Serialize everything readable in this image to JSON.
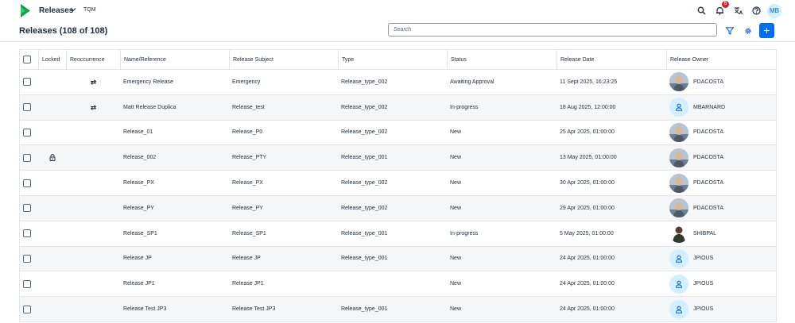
{
  "shell": {
    "app_title": "Releases",
    "app_subtitle": "TQM",
    "notification_count": "5",
    "user_initials": "MB"
  },
  "page": {
    "title": "Releases (108 of 108)",
    "search_placeholder": "Search",
    "add_label": "+"
  },
  "colors": {
    "accent": "#0070f2",
    "badge": "#d32030",
    "logo_green": "#1a9f4b"
  },
  "table": {
    "columns": {
      "locked": "Locked",
      "reoccurrence": "Reoccurrence",
      "name": "Name/Reference",
      "subject": "Release Subject",
      "type": "Type",
      "status": "Status",
      "date": "Release Date",
      "owner": "Release Owner"
    },
    "rows": [
      {
        "locked": false,
        "recurring": true,
        "name": "Emergency Release",
        "subject": "Emergency",
        "type": "Release_type_002",
        "status": "Awaiting Approval",
        "date": "11 Sept 2025, 16:23:25",
        "owner": "PDACOSTA",
        "avatar": "photo-a"
      },
      {
        "locked": false,
        "recurring": true,
        "name": "Matt Release Duplica",
        "subject": "Release_test",
        "type": "Release_type_002",
        "status": "In-progress",
        "date": "18 Aug 2025, 12:00:00",
        "owner": "MBARNARD",
        "avatar": "placeholder"
      },
      {
        "locked": false,
        "recurring": false,
        "name": "Release_01",
        "subject": "Release_P0",
        "type": "Release_type_002",
        "status": "New",
        "date": "25 Apr 2025, 01:00:00",
        "owner": "PDACOSTA",
        "avatar": "photo-a"
      },
      {
        "locked": true,
        "recurring": false,
        "name": "Release_002",
        "subject": "Release_PTY",
        "type": "Release_type_001",
        "status": "New",
        "date": "13 May 2025, 01:00:00",
        "owner": "PDACOSTA",
        "avatar": "photo-a"
      },
      {
        "locked": false,
        "recurring": false,
        "name": "Release_PX",
        "subject": "Release_PX",
        "type": "Release_type_002",
        "status": "New",
        "date": "30 Apr 2025, 01:00:00",
        "owner": "PDACOSTA",
        "avatar": "photo-a"
      },
      {
        "locked": false,
        "recurring": false,
        "name": "Release_PY",
        "subject": "Release_PY",
        "type": "Release_type_002",
        "status": "New",
        "date": "29 Apr 2025, 01:00:00",
        "owner": "PDACOSTA",
        "avatar": "photo-a"
      },
      {
        "locked": false,
        "recurring": false,
        "name": "Release_SP1",
        "subject": "Release_SP1",
        "type": "Release_type_001",
        "status": "In-progress",
        "date": "5 May 2025, 01:00:00",
        "owner": "SHIBPAL",
        "avatar": "photo-b"
      },
      {
        "locked": false,
        "recurring": false,
        "name": "Release JP",
        "subject": "Release JP",
        "type": "Release_type_001",
        "status": "New",
        "date": "24 Apr 2025, 01:00:00",
        "owner": "JPIOUS",
        "avatar": "placeholder"
      },
      {
        "locked": false,
        "recurring": false,
        "name": "Release JP1",
        "subject": "Release JP1",
        "type": "",
        "status": "New",
        "date": "24 Apr 2025, 01:00:00",
        "owner": "JPIOUS",
        "avatar": "placeholder"
      },
      {
        "locked": false,
        "recurring": false,
        "name": "Release Test JP3",
        "subject": "Release Test JP3",
        "type": "Release_type_001",
        "status": "New",
        "date": "24 Apr 2025, 01:00:00",
        "owner": "JPIOUS",
        "avatar": "placeholder"
      }
    ]
  }
}
